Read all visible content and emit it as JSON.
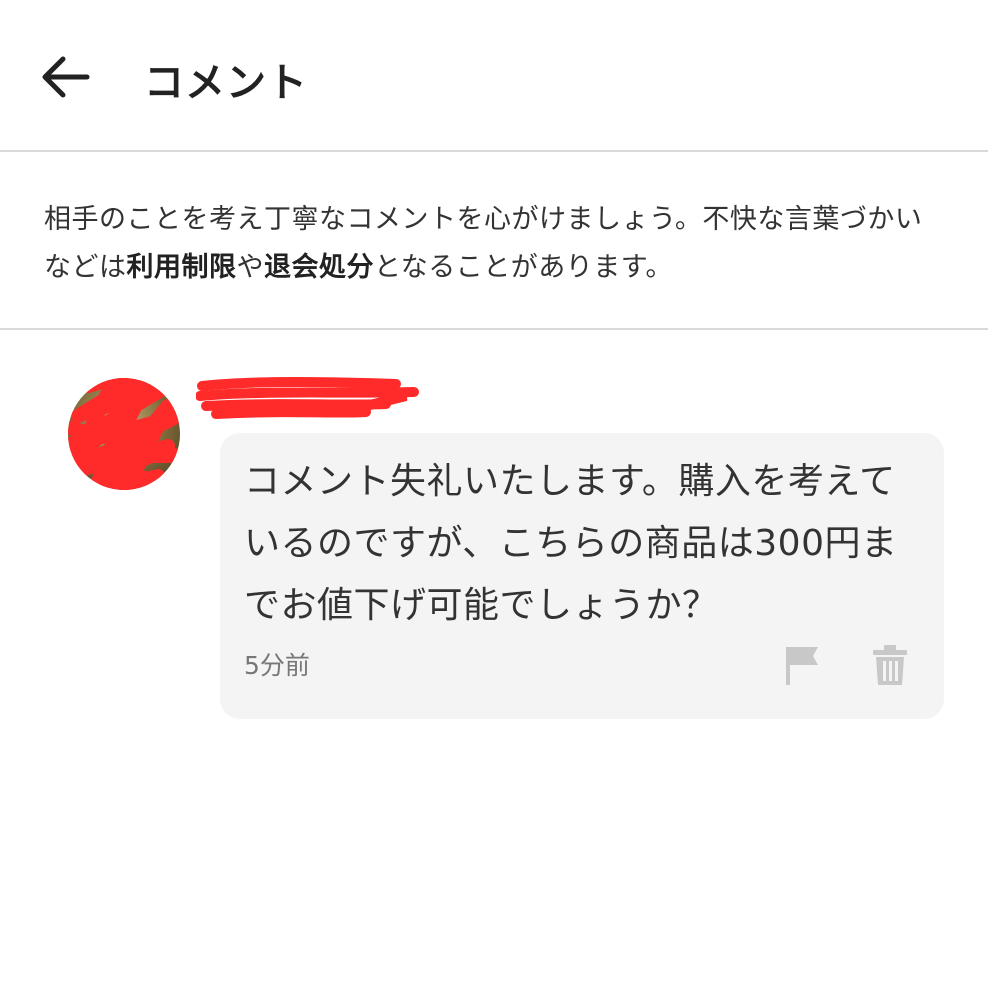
{
  "header": {
    "back_icon": "arrow-left-icon",
    "title": "コメント"
  },
  "notice": {
    "part1": "相手のことを考え丁寧なコメントを心がけましょう。不快な言葉づかいなどは",
    "bold1": "利用制限",
    "part2": "や",
    "bold2": "退会処分",
    "part3": "となることがあります。"
  },
  "comment": {
    "avatar_icon": "avatar-redacted",
    "username_icon": "username-redacted",
    "text": "コメント失礼いたします。購入を考えているのですが、こちらの商品は300円までお値下げ可能でしょうか？",
    "timestamp": "5分前",
    "flag_icon": "flag-icon",
    "trash_icon": "trash-icon"
  },
  "colors": {
    "redaction": "#ff2a2a",
    "bubble_bg": "#f4f4f4",
    "divider": "#d9d9d9",
    "icon_gray": "#c8c8c8"
  }
}
